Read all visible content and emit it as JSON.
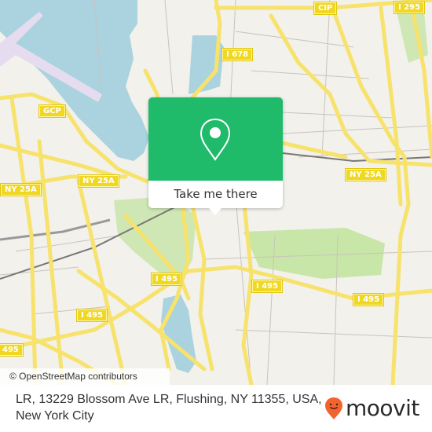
{
  "map": {
    "attribution": "© OpenStreetMap contributors",
    "road_shields": [
      {
        "label": "CIP"
      },
      {
        "label": "I 295"
      },
      {
        "label": "I 678"
      },
      {
        "label": "GCP"
      },
      {
        "label": "NY 25A"
      },
      {
        "label": "NY 25A"
      },
      {
        "label": "NY 25A"
      },
      {
        "label": "I 495"
      },
      {
        "label": "I 495"
      },
      {
        "label": "I 495"
      },
      {
        "label": "I 495"
      },
      {
        "label": "495"
      }
    ],
    "colors": {
      "land": "#f2f1ec",
      "water": "#aad3df",
      "park": "#c8e6a8",
      "highway": "#f7e26b",
      "airport": "#e6dcef"
    }
  },
  "popup": {
    "icon": "map-pin-icon",
    "cta_label": "Take me there",
    "accent_color": "#1fba6a"
  },
  "footer": {
    "address": "LR, 13229 Blossom Ave LR, Flushing, NY 11355, USA, New York City",
    "brand": "moovit",
    "brand_icon": "moovit-pin-logo-icon",
    "brand_color": "#f26330"
  }
}
